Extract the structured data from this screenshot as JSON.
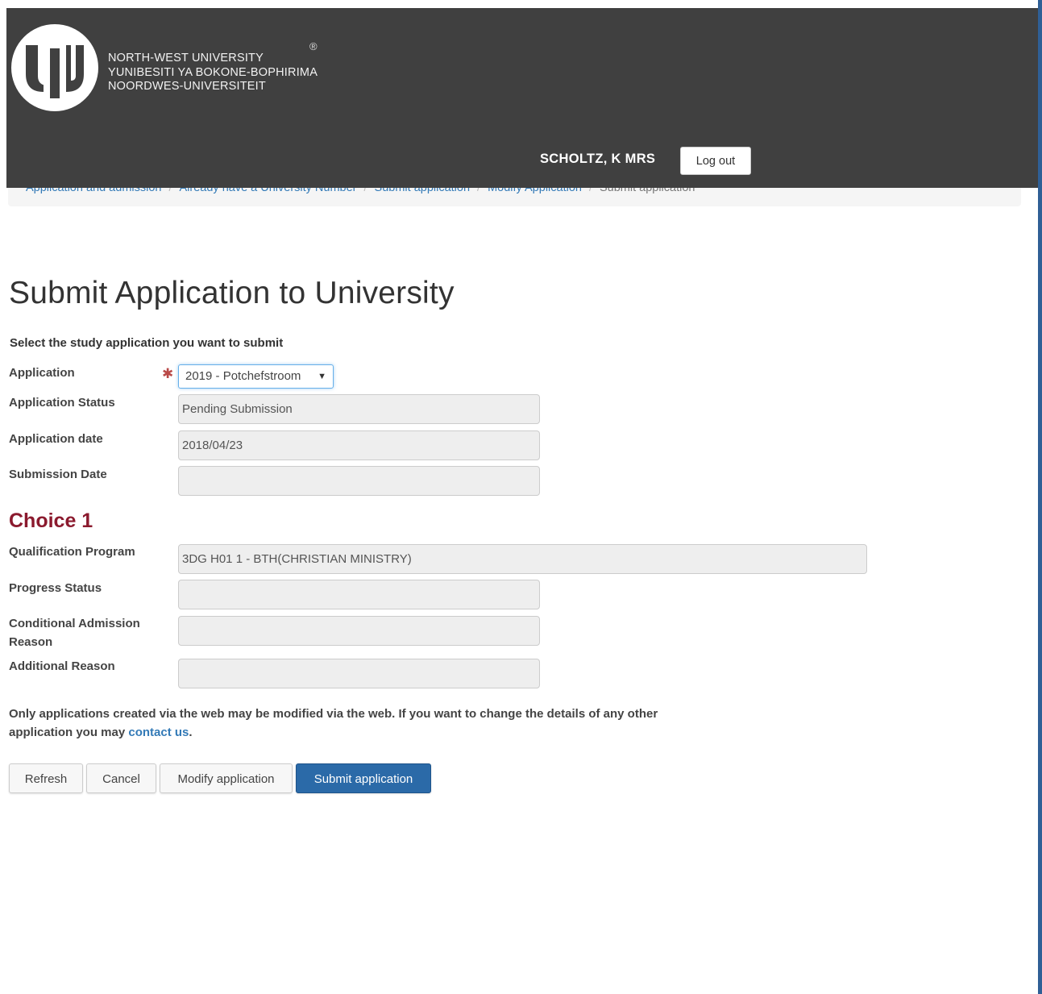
{
  "header": {
    "logo_lines": [
      "NORTH-WEST UNIVERSITY",
      "YUNIBESITI YA BOKONE-BOPHIRIMA",
      "NOORDWES-UNIVERSITEIT"
    ],
    "registered_mark": "®",
    "user_name": "SCHOLTZ, K MRS",
    "logout_label": "Log out"
  },
  "breadcrumb": {
    "items": [
      "Application and admission",
      "Already have a University Number",
      "Submit application",
      "Modify Application"
    ],
    "current": "Submit application",
    "separator": "/"
  },
  "page": {
    "title": "Submit Application to University",
    "subtitle": "Select the study application you want to submit"
  },
  "form": {
    "application": {
      "label": "Application",
      "value": "2019 - Potchefstroom",
      "required_mark": "✱"
    },
    "status": {
      "label": "Application Status",
      "value": "Pending Submission"
    },
    "date": {
      "label": "Application date",
      "value": "2018/04/23"
    },
    "submission": {
      "label": "Submission Date",
      "value": ""
    }
  },
  "choice": {
    "heading": "Choice 1",
    "qualification": {
      "label": "Qualification Program",
      "value": "3DG H01 1 - BTH(CHRISTIAN MINISTRY)"
    },
    "progress": {
      "label": "Progress Status",
      "value": ""
    },
    "conditional": {
      "label": "Conditional Admission Reason",
      "value": ""
    },
    "additional": {
      "label": "Additional Reason",
      "value": ""
    }
  },
  "note": {
    "text": "Only applications created via the web may be modified via the web. If you want to change the details of any other application you may",
    "link": "contact us",
    "end": "."
  },
  "buttons": {
    "refresh": "Refresh",
    "cancel": "Cancel",
    "modify": "Modify application",
    "submit": "Submit application"
  },
  "colors": {
    "header_bg": "#404040",
    "primary": "#2b6aa8",
    "section_heading": "#8b1a2e",
    "link": "#337ab7"
  }
}
